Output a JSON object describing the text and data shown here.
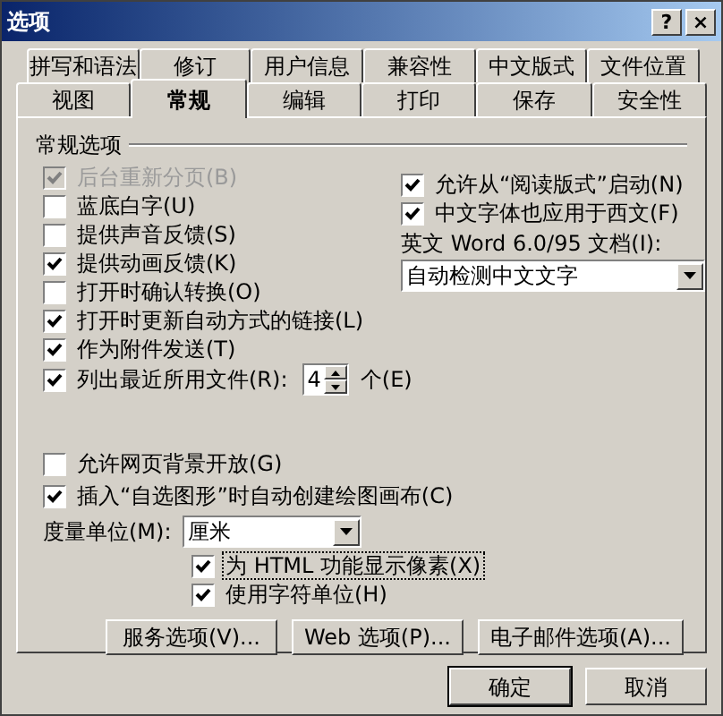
{
  "window": {
    "title": "选项",
    "controls": [
      "?",
      "×"
    ]
  },
  "tab_rows": [
    [
      {
        "label": "拼写和语法",
        "selected": false
      },
      {
        "label": "修订",
        "selected": false
      },
      {
        "label": "用户信息",
        "selected": false
      },
      {
        "label": "兼容性",
        "selected": false
      },
      {
        "label": "中文版式",
        "selected": false
      },
      {
        "label": "文件位置",
        "selected": false
      }
    ],
    [
      {
        "label": "视图",
        "selected": false
      },
      {
        "label": "常规",
        "selected": true
      },
      {
        "label": "编辑",
        "selected": false
      },
      {
        "label": "打印",
        "selected": false
      },
      {
        "label": "保存",
        "selected": false
      },
      {
        "label": "安全性",
        "selected": false
      }
    ]
  ],
  "group_title": "常规选项",
  "left_options": [
    {
      "label": "后台重新分页(B)",
      "checked": true,
      "disabled": true
    },
    {
      "label": "蓝底白字(U)",
      "checked": false,
      "disabled": false
    },
    {
      "label": "提供声音反馈(S)",
      "checked": false,
      "disabled": false
    },
    {
      "label": "提供动画反馈(K)",
      "checked": true,
      "disabled": false
    },
    {
      "label": "打开时确认转换(O)",
      "checked": false,
      "disabled": false
    },
    {
      "label": "打开时更新自动方式的链接(L)",
      "checked": true,
      "disabled": false
    },
    {
      "label": "作为附件发送(T)",
      "checked": true,
      "disabled": false
    }
  ],
  "recent_files": {
    "label": "列出最近所用文件(R):",
    "checked": true,
    "value": "4",
    "unit": "个(E)"
  },
  "right_options": [
    {
      "label": "允许从“阅读版式”启动(N)",
      "checked": true
    },
    {
      "label": "中文字体也应用于西文(F)",
      "checked": true
    }
  ],
  "compat": {
    "label": "英文 Word 6.0/95 文档(I):",
    "value": "自动检测中文文字"
  },
  "web_options": [
    {
      "label": "允许网页背景开放(G)",
      "checked": false
    },
    {
      "label": "插入“自选图形”时自动创建绘图画布(C)",
      "checked": true
    }
  ],
  "measure": {
    "label": "度量单位(M):",
    "value": "厘米"
  },
  "sub_options": [
    {
      "label": "为 HTML 功能显示像素(X)",
      "checked": true,
      "focused": true
    },
    {
      "label": "使用字符单位(H)",
      "checked": true,
      "focused": false
    }
  ],
  "option_buttons": [
    "服务选项(V)...",
    "Web 选项(P)...",
    "电子邮件选项(A)..."
  ],
  "buttons": [
    "确定",
    "取消"
  ]
}
